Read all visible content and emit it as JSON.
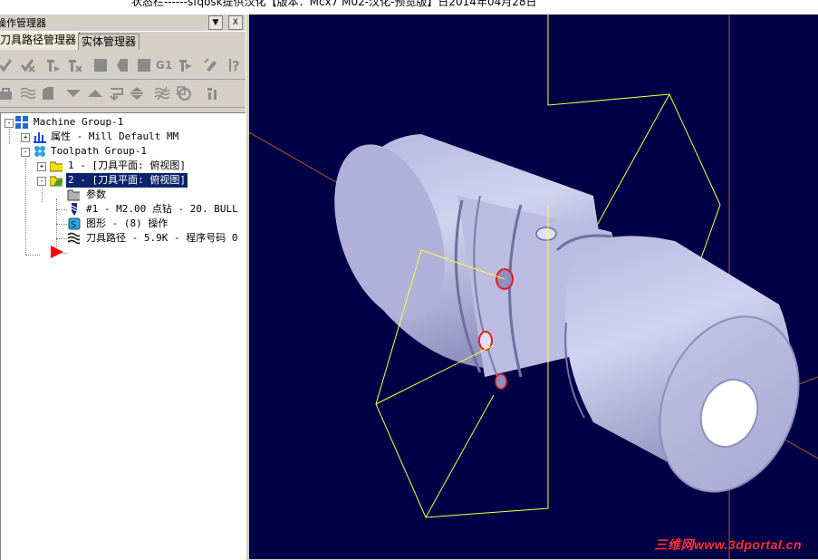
{
  "window": {
    "title": "状态栏------sfqosk提供汉化【版本：Mcx7 M02-汉化-预览版】日2014年04月28日"
  },
  "panel": {
    "title": "操作管理器",
    "dropdown_glyph": "▼",
    "close_glyph": "X",
    "tabs": [
      {
        "label": "刀具路径管理器",
        "active": true
      },
      {
        "label": "实体管理器",
        "active": false
      }
    ],
    "toolbar1_icons": [
      "select-all-icon",
      "select-invalid-icon",
      "regen-selected-icon",
      "regen-invalid-icon",
      "backplot-icon",
      "verify-icon",
      "simulate-icon",
      "post-g1-icon",
      "high-speed-icon",
      "lock-icon",
      "help-icon"
    ],
    "toolbar1_g1_label": "G1",
    "toolbar2_icons": [
      "lock-toggle-icon",
      "toggle-display-icon",
      "post-toggle-icon",
      "move-down-icon",
      "move-up-icon",
      "insert-arrow-icon",
      "scroll-icon",
      "wave-icon",
      "only-display-icon",
      "tool-options-icon"
    ]
  },
  "tree": {
    "nodes": [
      {
        "label": "Machine Group-1",
        "icon": "machine-group-icon",
        "expander": "-"
      },
      {
        "label": "属性 - Mill Default MM",
        "icon": "properties-icon",
        "expander": "+"
      },
      {
        "label": "Toolpath Group-1",
        "icon": "toolpath-group-icon",
        "expander": "-"
      },
      {
        "label": "1 - [刀具平面: 俯视图]",
        "icon": "folder-icon",
        "expander": "+"
      },
      {
        "label": "2 - [刀具平面: 俯视图]",
        "icon": "folder-open-icon",
        "expander": "-",
        "selected": true
      },
      {
        "label": "参数",
        "icon": "parameters-icon"
      },
      {
        "label": "#1 - M2.00 点钻 -    20. BULL",
        "icon": "drill-tool-icon"
      },
      {
        "label": "图形 - (8) 操作",
        "icon": "geometry-icon"
      },
      {
        "label": "刀具路径 - 5.9K - 程序号码 0",
        "icon": "toolpath-icon"
      }
    ],
    "insert_arrow_icon": "insert-position-arrow-icon"
  },
  "viewport": {
    "background": "#000046",
    "part_color": "#bfbfe6",
    "wireframe_color": "#ffff40",
    "axis_color": "#b05a20",
    "watermark": "三维网www.3dportal.cn"
  }
}
